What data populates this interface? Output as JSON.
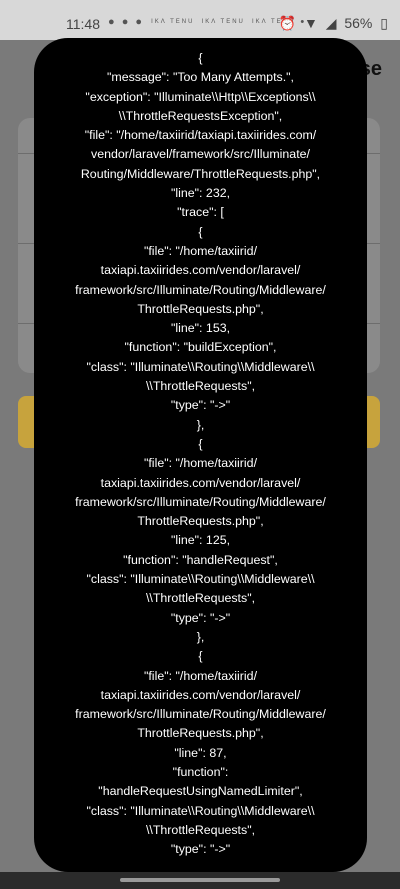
{
  "status_bar": {
    "time": "11:48",
    "app_icons": "● ● ●",
    "mini_labels": [
      "ΙΚΛ TENU",
      "ΙΚΛ TENU",
      "ΙΚΛ TENU"
    ],
    "dot": "•",
    "alarm_icon": "⏰",
    "wifi_icon": "▼",
    "signal_icon": "◢",
    "battery_text": "56%",
    "battery_icon": "▯"
  },
  "background_app": {
    "header_fragment": "se"
  },
  "error_dialog": {
    "body": "{\n\"message\": \"Too Many Attempts.\",\n\"exception\": \"Illuminate\\\\Http\\\\Exceptions\\\\\n\\\\ThrottleRequestsException\",\n\"file\": \"/home/taxiirid/taxiapi.taxiirides.com/\nvendor/laravel/framework/src/Illuminate/\nRouting/Middleware/ThrottleRequests.php\",\n\"line\": 232,\n\"trace\": [\n{\n\"file\": \"/home/taxiirid/\ntaxiapi.taxiirides.com/vendor/laravel/\nframework/src/Illuminate/Routing/Middleware/\nThrottleRequests.php\",\n\"line\": 153,\n\"function\": \"buildException\",\n\"class\": \"Illuminate\\\\Routing\\\\Middleware\\\\\n\\\\ThrottleRequests\",\n\"type\": \"->\"\n},\n{\n\"file\": \"/home/taxiirid/\ntaxiapi.taxiirides.com/vendor/laravel/\nframework/src/Illuminate/Routing/Middleware/\nThrottleRequests.php\",\n\"line\": 125,\n\"function\": \"handleRequest\",\n\"class\": \"Illuminate\\\\Routing\\\\Middleware\\\\\n\\\\ThrottleRequests\",\n\"type\": \"->\"\n},\n{\n\"file\": \"/home/taxiirid/\ntaxiapi.taxiirides.com/vendor/laravel/\nframework/src/Illuminate/Routing/Middleware/\nThrottleRequests.php\",\n\"line\": 87,\n\"function\":\n\"handleRequestUsingNamedLimiter\",\n\"class\": \"Illuminate\\\\Routing\\\\Middleware\\\\\n\\\\ThrottleRequests\",\n\"type\": \"->\""
  },
  "colors": {
    "dialog_background": "#000000",
    "dialog_text": "#ffffff",
    "accent_button": "#c7a33d"
  }
}
